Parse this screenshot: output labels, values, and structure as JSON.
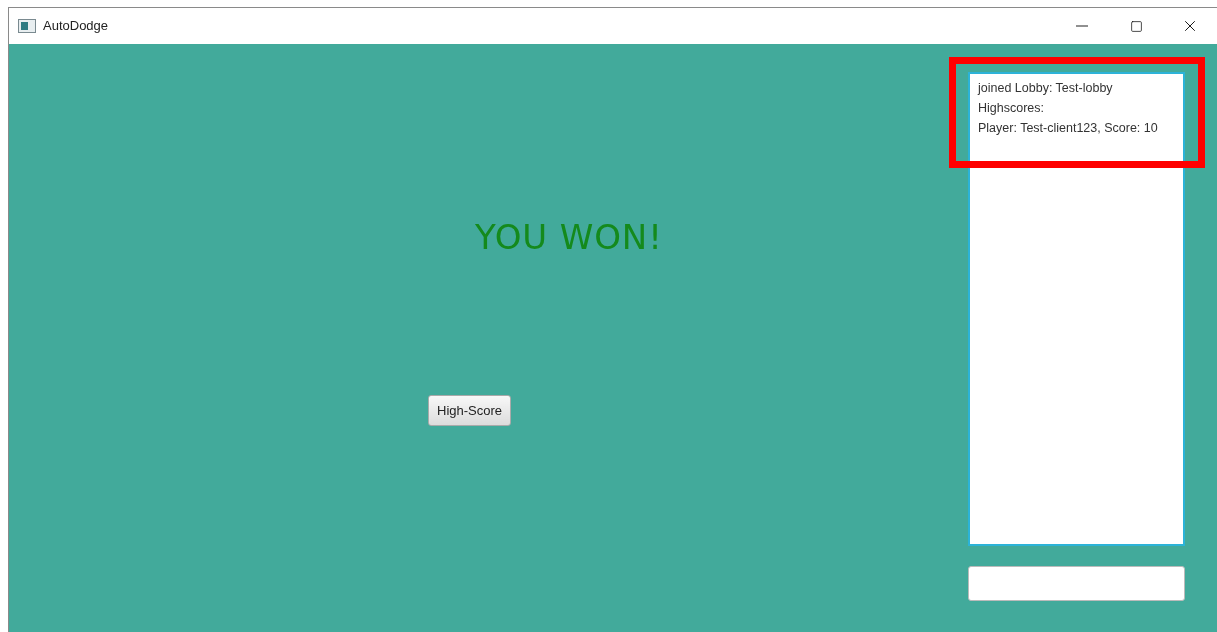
{
  "window": {
    "title": "AutoDodge"
  },
  "result": {
    "text": "YOU WON!"
  },
  "buttons": [
    {
      "label": "High-Score"
    }
  ],
  "chat_log": {
    "highlighted": true,
    "lines": [
      "joined Lobby: Test-lobby",
      "Highscores:",
      "Player: Test-client123, Score: 10"
    ]
  },
  "message_field": {
    "kind": "input"
  }
}
